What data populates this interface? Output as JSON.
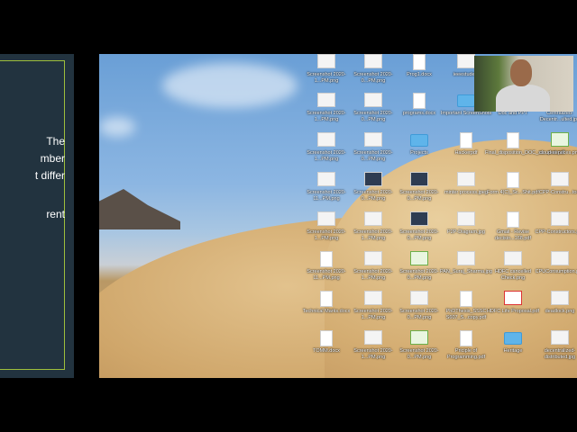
{
  "slide": {
    "lines": [
      "The",
      "mber",
      "t differ",
      "rent"
    ]
  },
  "desktop": {
    "icons": [
      {
        "label": "Screenshot 2020-1...PM.png",
        "kind": "img"
      },
      {
        "label": "Screenshot 2020-0...PM.png",
        "kind": "img"
      },
      {
        "label": "Prog1.docx",
        "kind": "doc"
      },
      {
        "label": "ieeestudent",
        "kind": "img"
      },
      {
        "label": "",
        "kind": "none"
      },
      {
        "label": "",
        "kind": "none"
      },
      {
        "label": "Screenshot 2020-1...PM.png",
        "kind": "img"
      },
      {
        "label": "Screenshot 2020-0...PM.png",
        "kind": "img"
      },
      {
        "label": "programs.docx",
        "kind": "doc"
      },
      {
        "label": "Important ScreenShots",
        "kind": "folder"
      },
      {
        "label": "Doc and PPT",
        "kind": "folder"
      },
      {
        "label": "Centralized-Decentr...ulted.jpg",
        "kind": "img"
      },
      {
        "label": "Screenshot 2020-1...PM.png",
        "kind": "img"
      },
      {
        "label": "Screenshot 2020-0...PM.png",
        "kind": "img"
      },
      {
        "label": "Projects",
        "kind": "folder"
      },
      {
        "label": "Hackerpdf",
        "kind": "doc"
      },
      {
        "label": "Final_disposition_DOC_su...port.pdf",
        "kind": "doc"
      },
      {
        "label": "cloud-services.png",
        "kind": "green"
      },
      {
        "label": "Screenshot 2020-11...PM.png",
        "kind": "img"
      },
      {
        "label": "Screenshot 2020-0...PM.png",
        "kind": "dark"
      },
      {
        "label": "Screenshot 2020-0...PM.png",
        "kind": "dark"
      },
      {
        "label": "minter process.jpeg",
        "kind": "img"
      },
      {
        "label": "Form 4(C)_Sc...Shit.pdf",
        "kind": "doc"
      },
      {
        "label": "CPP-Constru...tors",
        "kind": "img"
      },
      {
        "label": "Screenshot 2020-1...PM.png",
        "kind": "img"
      },
      {
        "label": "Screenshot 2020-1...PM.png",
        "kind": "img"
      },
      {
        "label": "Screenshot 2020-0...PM.png",
        "kind": "dark"
      },
      {
        "label": "P2P-Diagram.jpg",
        "kind": "img"
      },
      {
        "label": "Gmail - Revise decisio...168.pdf",
        "kind": "doc"
      },
      {
        "label": "CPP-Constructors.png",
        "kind": "img"
      },
      {
        "label": "Screenshot 2020-11...PM.png",
        "kind": "doc"
      },
      {
        "label": "Screenshot 2020-1...PM.png",
        "kind": "img"
      },
      {
        "label": "Screenshot 2020-0...PM.png",
        "kind": "green"
      },
      {
        "label": "PAN_Suraj_Sharma.jpg",
        "kind": "img"
      },
      {
        "label": "HDFC cancelled Check.png",
        "kind": "img"
      },
      {
        "label": "CPUConsumption.png",
        "kind": "img"
      },
      {
        "label": "Technical Marks.docx",
        "kind": "doc"
      },
      {
        "label": "Screenshot 2020-1...PM.png",
        "kind": "img"
      },
      {
        "label": "Screenshot 2020-0...PM.png",
        "kind": "img"
      },
      {
        "label": "PhDThesis_SSSC S607_S...copy.pdf",
        "kind": "doc"
      },
      {
        "label": "HDFC Life Proposal.pdf",
        "kind": "red"
      },
      {
        "label": "deadlock.png",
        "kind": "img"
      },
      {
        "label": "TOMM.docx",
        "kind": "doc"
      },
      {
        "label": "Screenshot 2020-1...PM.png",
        "kind": "img"
      },
      {
        "label": "Screenshot 2020-0...PM.png",
        "kind": "green"
      },
      {
        "label": "Priciple of Programming.pdf",
        "kind": "doc"
      },
      {
        "label": "Heritage",
        "kind": "folder"
      },
      {
        "label": "decentralized-distributed.jpg",
        "kind": "img"
      }
    ]
  }
}
